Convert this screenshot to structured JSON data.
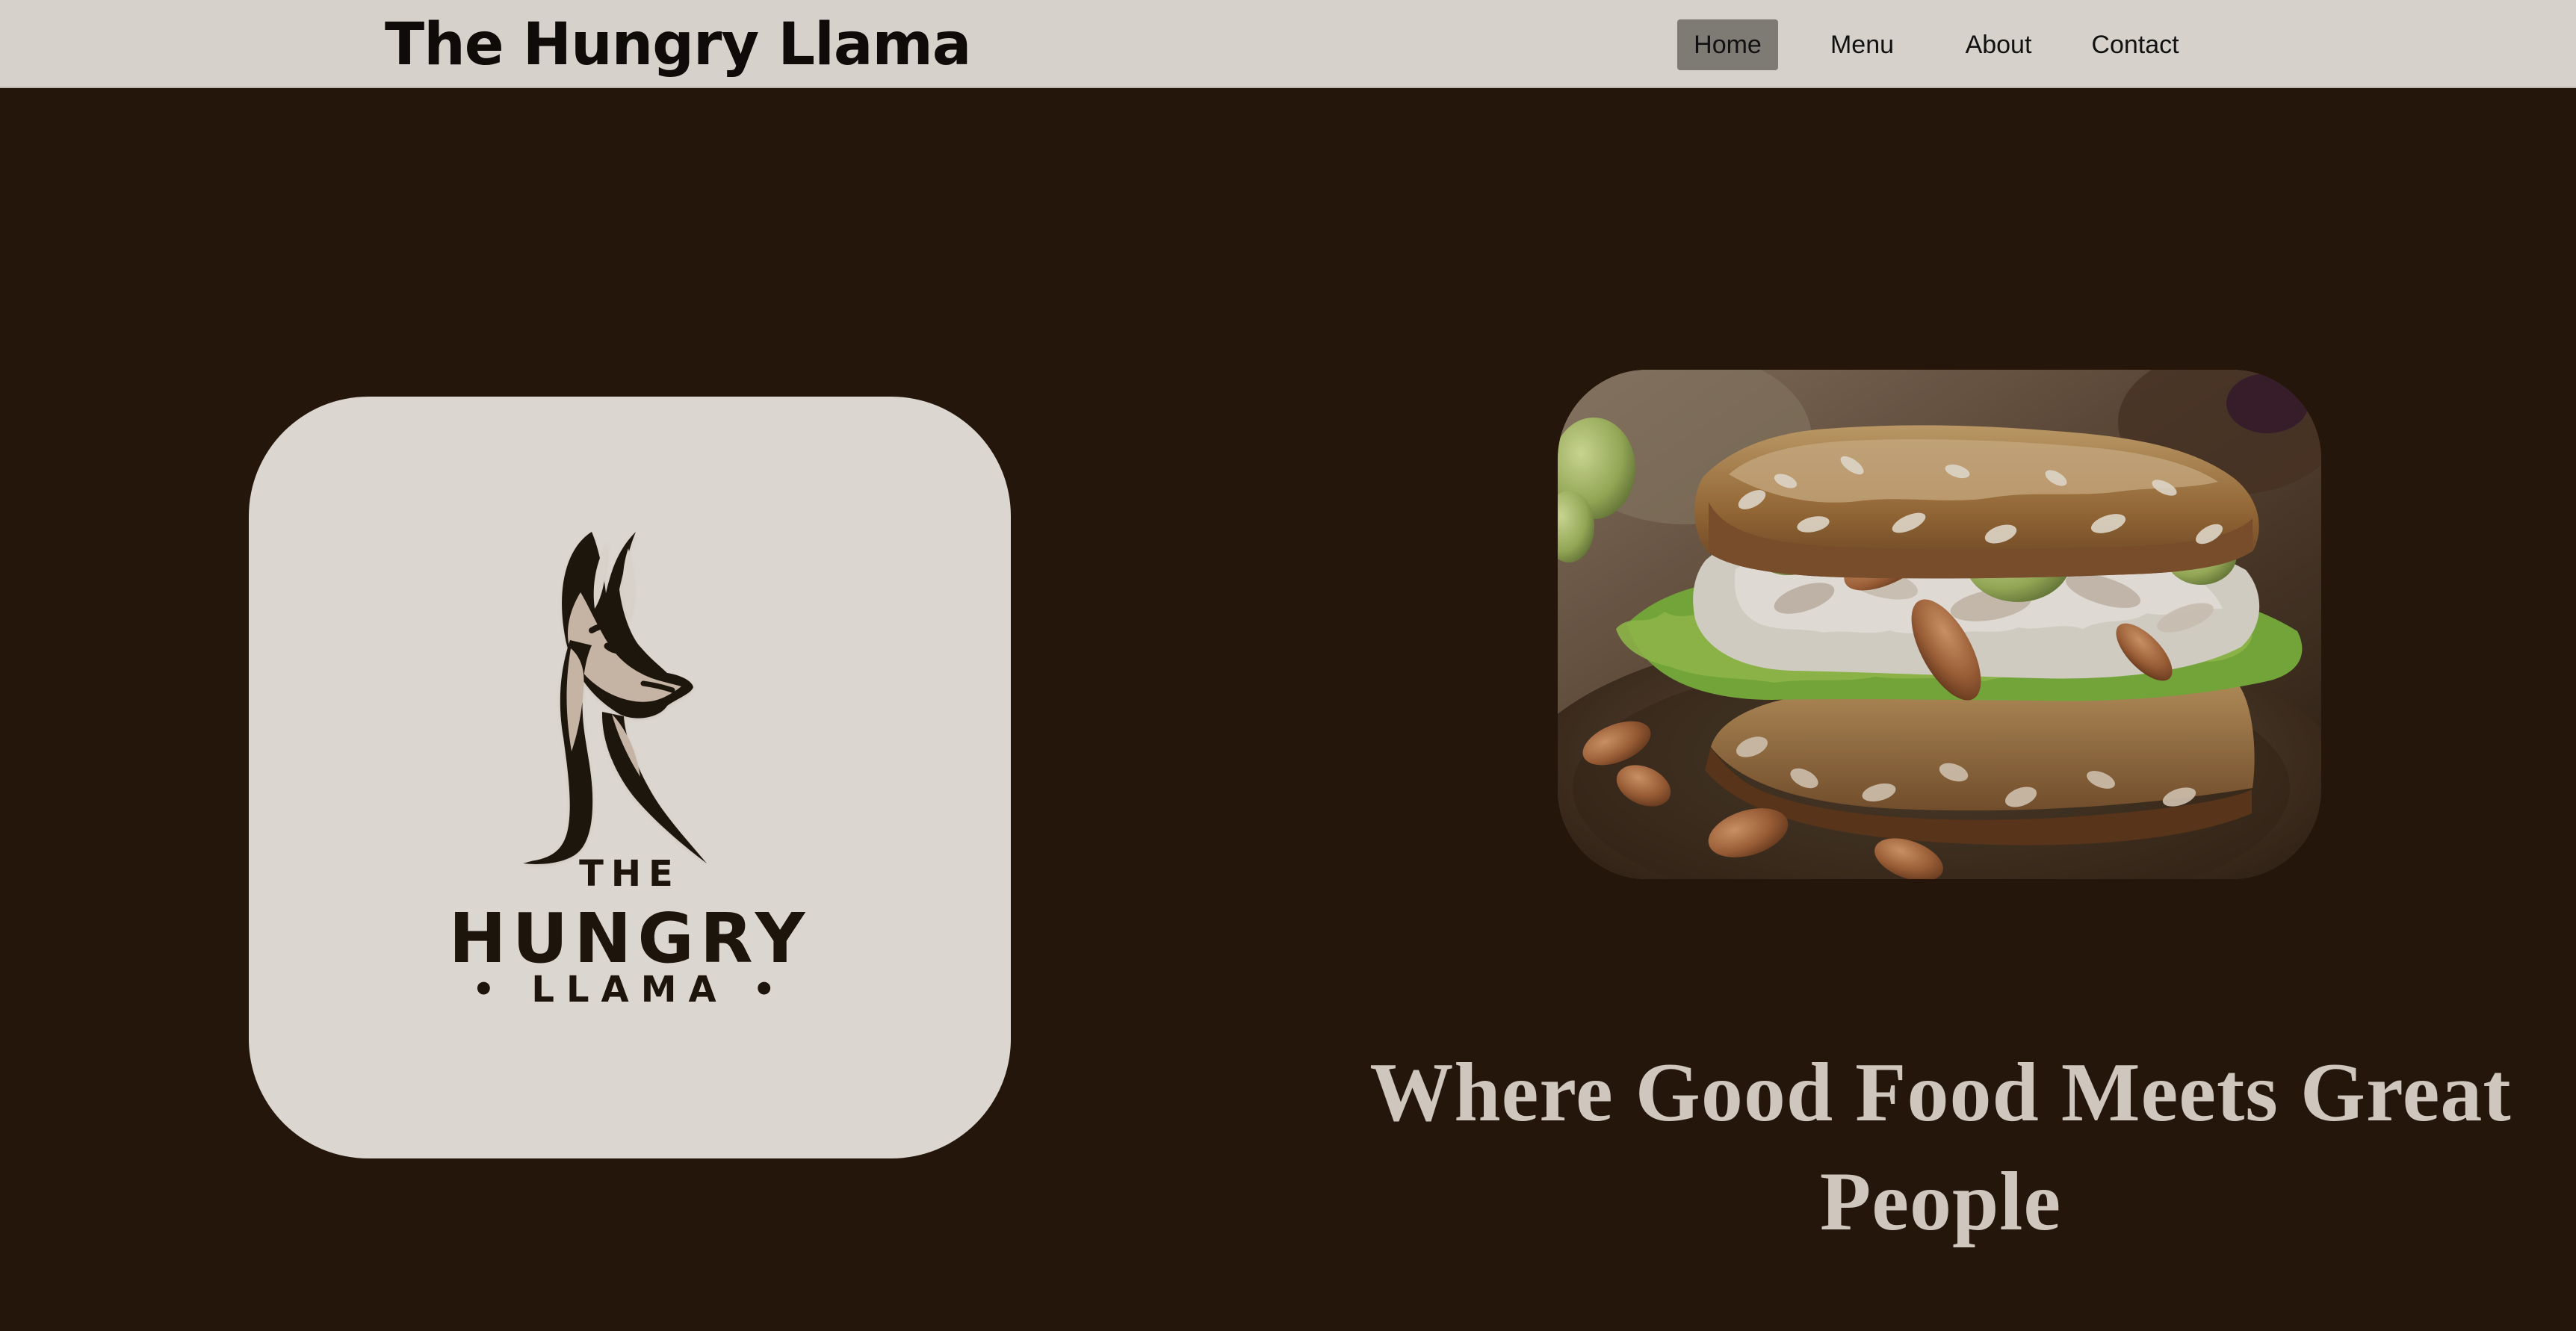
{
  "header": {
    "brand": "The Hungry Llama",
    "nav": [
      {
        "label": "Home",
        "active": true
      },
      {
        "label": "Menu",
        "active": false
      },
      {
        "label": "About",
        "active": false
      },
      {
        "label": "Contact",
        "active": false
      }
    ]
  },
  "logo": {
    "line1": "THE",
    "line2": "HUNGRY",
    "line3": "• LLAMA •",
    "icon": "llama-head-icon"
  },
  "hero": {
    "tagline": "Where Good Food Meets Great People",
    "image": "sandwich-photo"
  },
  "colors": {
    "nav_bg": "#d6d1cb",
    "page_bg": "#24160b",
    "card_bg": "#dbd6cf",
    "tagline_text": "#cfc6bd",
    "active_nav_bg": "#7e7a74"
  }
}
